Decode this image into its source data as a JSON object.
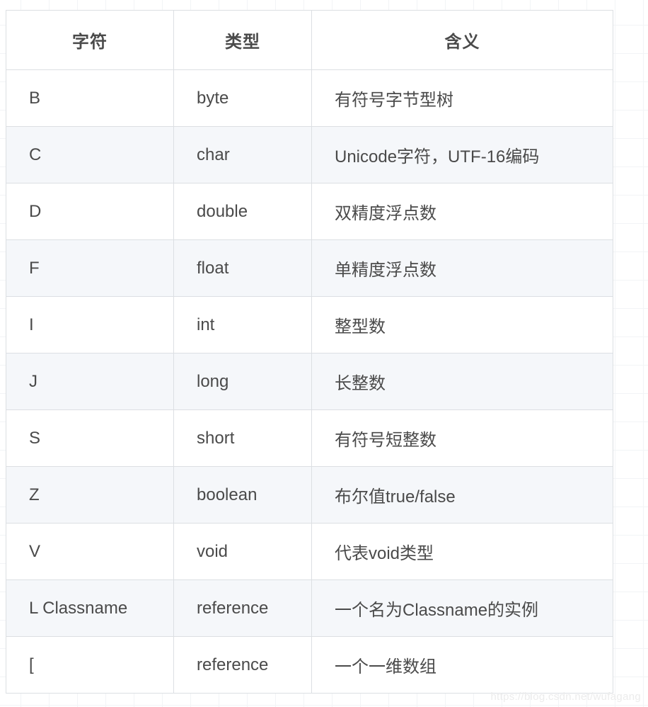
{
  "table": {
    "headers": {
      "character": "字符",
      "type": "类型",
      "meaning": "含义"
    },
    "rows": [
      {
        "character": "B",
        "type": "byte",
        "meaning": "有符号字节型树"
      },
      {
        "character": "C",
        "type": "char",
        "meaning": "Unicode字符，UTF-16编码"
      },
      {
        "character": "D",
        "type": "double",
        "meaning": "双精度浮点数"
      },
      {
        "character": "F",
        "type": "float",
        "meaning": "单精度浮点数"
      },
      {
        "character": "I",
        "type": "int",
        "meaning": "整型数"
      },
      {
        "character": "J",
        "type": "long",
        "meaning": "长整数"
      },
      {
        "character": "S",
        "type": "short",
        "meaning": "有符号短整数"
      },
      {
        "character": "Z",
        "type": "boolean",
        "meaning": "布尔值true/false"
      },
      {
        "character": "V",
        "type": "void",
        "meaning": "代表void类型"
      },
      {
        "character": "L Classname",
        "type": "reference",
        "meaning": "一个名为Classname的实例"
      },
      {
        "character": "[",
        "type": "reference",
        "meaning": "一个一维数组"
      }
    ]
  },
  "watermark": {
    "text": "https://blog.csdn.net/wufagang"
  },
  "colors": {
    "border": "#dcdfe3",
    "text": "#4a4a4a",
    "zebra_row": "#f5f7fa",
    "page_grid": "#f2f4f6",
    "watermark": "#ececec"
  }
}
